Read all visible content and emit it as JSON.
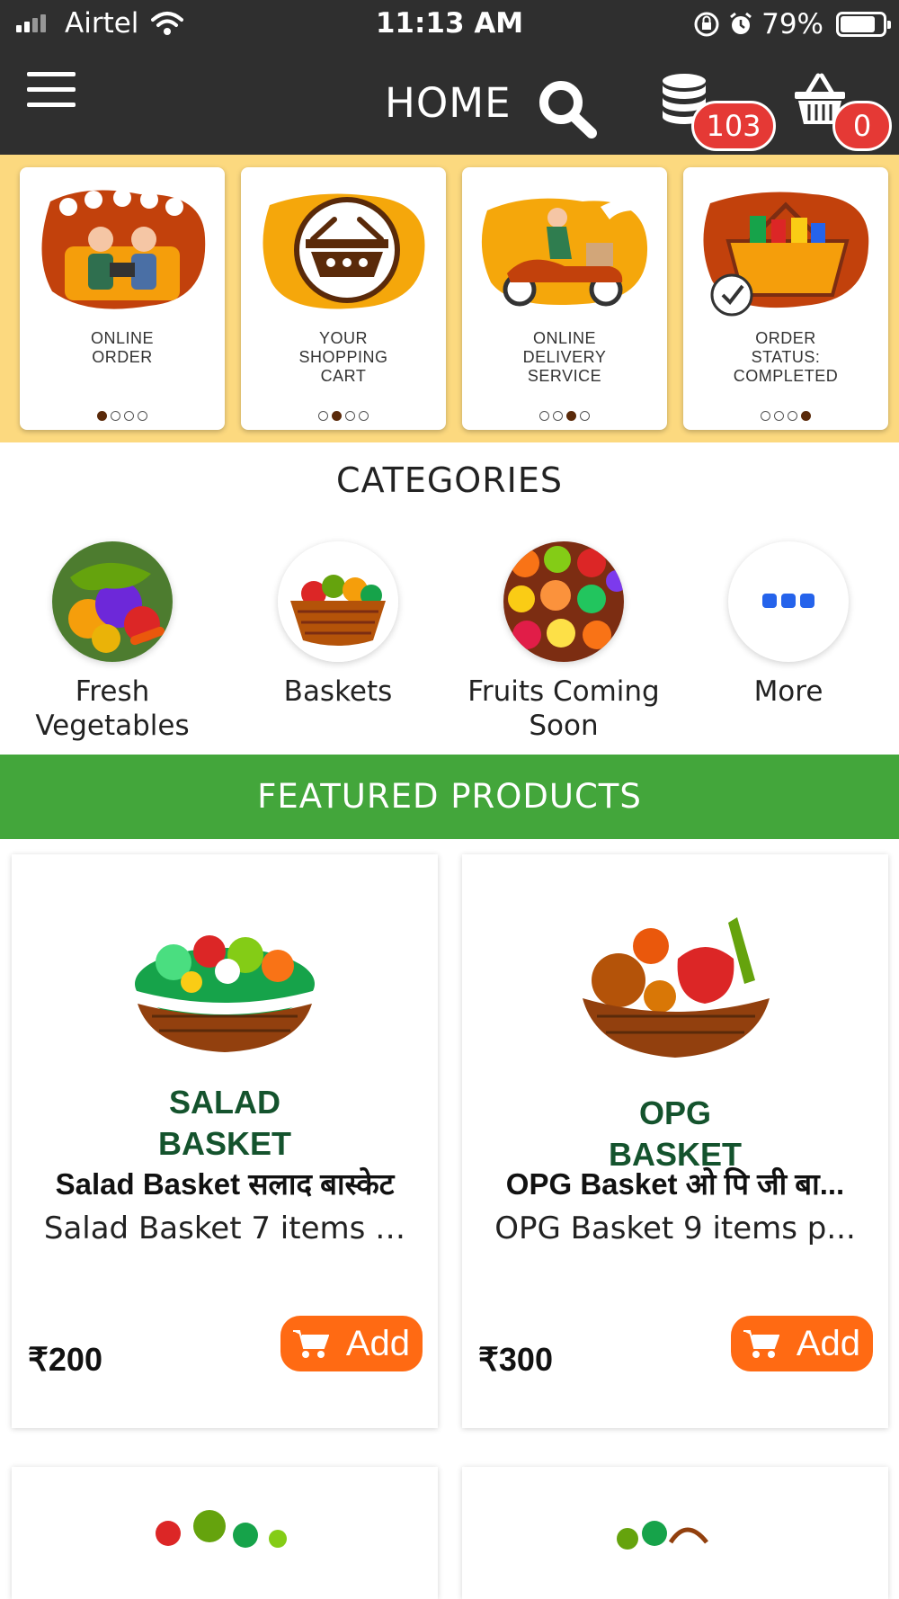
{
  "status_bar": {
    "carrier": "Airtel",
    "time": "11:13 AM",
    "battery": "79%"
  },
  "header": {
    "title": "HOME",
    "coins_count": "103",
    "cart_count": "0"
  },
  "promo_cards": [
    {
      "label": "ONLINE\nORDER",
      "active_dot": 0
    },
    {
      "label": "YOUR\nSHOPPING\nCART",
      "active_dot": 1
    },
    {
      "label": "ONLINE\nDELIVERY\nSERVICE",
      "active_dot": 2
    },
    {
      "label": "ORDER\nSTATUS:\nCOMPLETED",
      "active_dot": 3
    }
  ],
  "categories": {
    "title": "CATEGORIES",
    "items": [
      {
        "label": "Fresh Vegetables"
      },
      {
        "label": "Baskets"
      },
      {
        "label": "Fruits Coming Soon"
      },
      {
        "label": "More"
      }
    ]
  },
  "featured": {
    "title": "FEATURED PRODUCTS",
    "products": [
      {
        "image_text": [
          "SALAD",
          "BASKET"
        ],
        "name": "Salad Basket सलाद बास्केट",
        "description": "Salad Basket 7 items …",
        "price": "₹200",
        "add_label": "Add"
      },
      {
        "image_text": [
          "OPG",
          "BASKET"
        ],
        "name": "OPG Basket ओ पि जी बा...",
        "description": "OPG Basket 9 items p...",
        "price": "₹300",
        "add_label": "Add"
      }
    ]
  },
  "colors": {
    "header_bg": "#2f2f2f",
    "promo_bg": "#fcd97f",
    "featured_bg": "#43a63b",
    "add_button": "#ff6a13",
    "badge": "#e53935"
  }
}
